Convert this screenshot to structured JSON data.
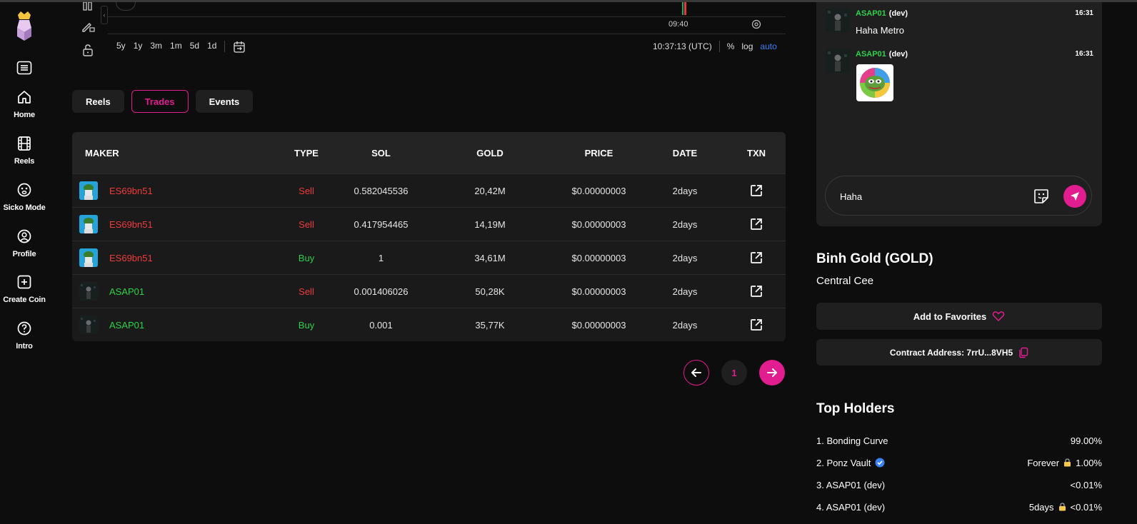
{
  "sidebar": {
    "items": [
      {
        "label": "Home",
        "icon": "home-icon"
      },
      {
        "label": "Reels",
        "icon": "film-icon"
      },
      {
        "label": "Sicko Mode",
        "icon": "face-icon"
      },
      {
        "label": "Profile",
        "icon": "user-icon"
      },
      {
        "label": "Create Coin",
        "icon": "plus-square-icon"
      },
      {
        "label": "Intro",
        "icon": "help-icon"
      }
    ]
  },
  "chart": {
    "time_label": "09:40",
    "ranges": [
      "5y",
      "1y",
      "3m",
      "1m",
      "5d",
      "1d"
    ],
    "clock": "10:37:13 (UTC)",
    "percent": "%",
    "log": "log",
    "auto": "auto"
  },
  "tabs": [
    "Reels",
    "Trades",
    "Events"
  ],
  "active_tab": "Trades",
  "trades": {
    "columns": [
      "MAKER",
      "TYPE",
      "SOL",
      "GOLD",
      "PRICE",
      "DATE",
      "TXN"
    ],
    "rows": [
      {
        "maker": "ES69bn51",
        "type": "Sell",
        "sol": "0.582045536",
        "gold": "20,42M",
        "price": "$0.00000003",
        "date": "2days"
      },
      {
        "maker": "ES69bn51",
        "type": "Sell",
        "sol": "0.417954465",
        "gold": "14,19M",
        "price": "$0.00000003",
        "date": "2days"
      },
      {
        "maker": "ES69bn51",
        "type": "Buy",
        "sol": "1",
        "gold": "34,61M",
        "price": "$0.00000003",
        "date": "2days"
      },
      {
        "maker": "ASAP01",
        "type": "Sell",
        "sol": "0.001406026",
        "gold": "50,28K",
        "price": "$0.00000003",
        "date": "2days"
      },
      {
        "maker": "ASAP01",
        "type": "Buy",
        "sol": "0.001",
        "gold": "35,77K",
        "price": "$0.00000003",
        "date": "2days"
      }
    ]
  },
  "pagination": {
    "page": "1"
  },
  "chat": {
    "messages": [
      {
        "name": "ASAP01",
        "tag": "(dev)",
        "time": "16:31",
        "text": "Haha Metro"
      },
      {
        "name": "ASAP01",
        "tag": "(dev)",
        "time": "16:31",
        "text": ""
      }
    ],
    "input_value": "Haha"
  },
  "coin": {
    "title": "Binh Gold (GOLD)",
    "subtitle": "Central Cee",
    "favorites_label": "Add to Favorites",
    "contract_label": "Contract Address: 7rrU...8VH5"
  },
  "holders": {
    "title": "Top Holders",
    "items": [
      {
        "name": "1. Bonding Curve",
        "extra": "",
        "value": "99.00%"
      },
      {
        "name": "2. Ponz Vault",
        "extra": "Forever",
        "value": "1.00%"
      },
      {
        "name": "3. ASAP01 (dev)",
        "extra": "",
        "value": "<0.01%"
      },
      {
        "name": "4. ASAP01 (dev)",
        "extra": "5days",
        "value": "<0.01%"
      }
    ]
  },
  "colors": {
    "accent": "#e11d8f",
    "buy": "#2ed14a",
    "sell": "#ef3b3b",
    "link": "#3b82f6"
  }
}
